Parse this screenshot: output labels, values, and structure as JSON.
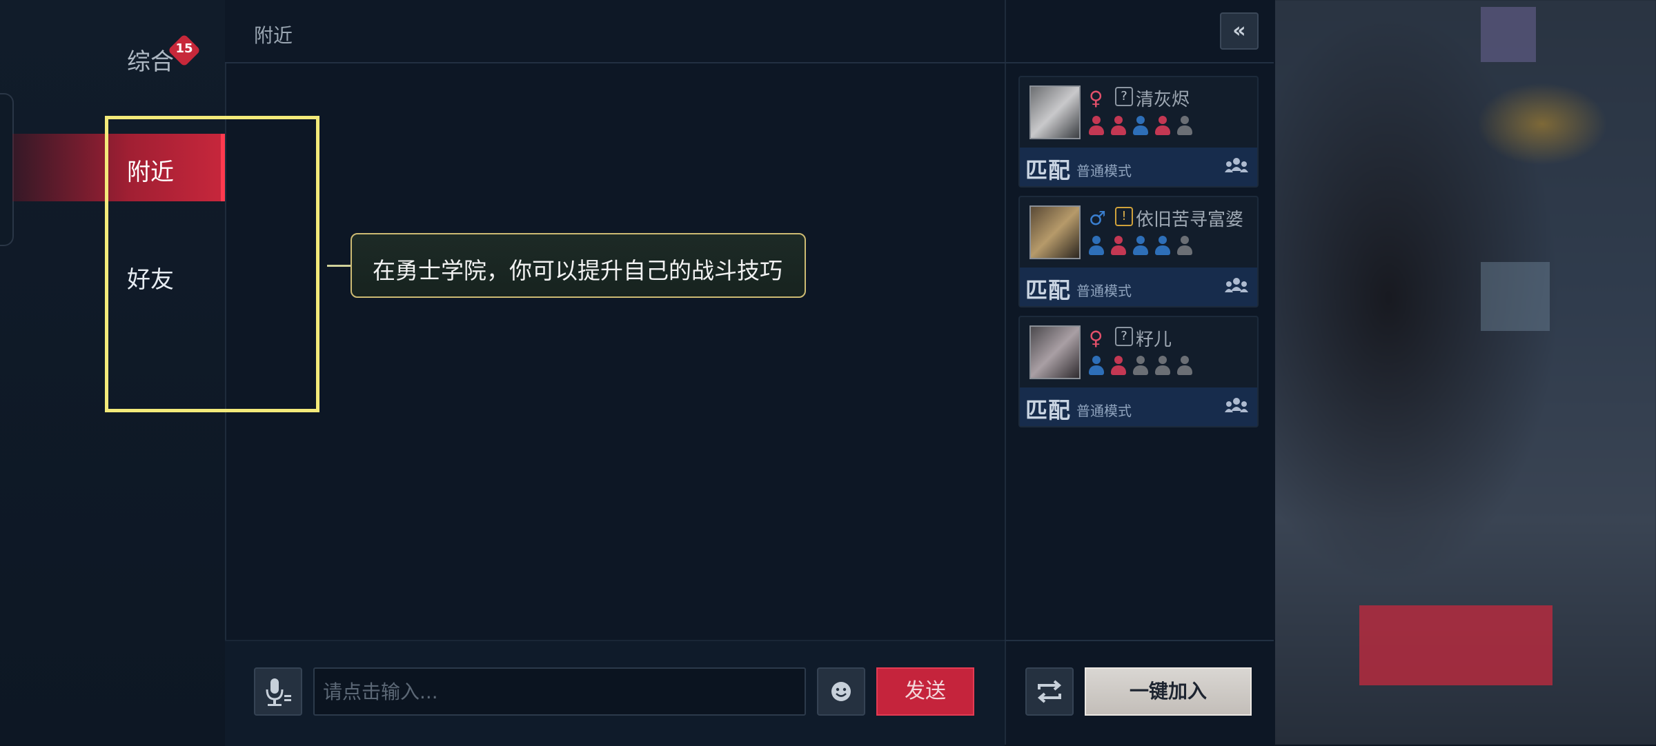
{
  "sidebar": {
    "items": [
      {
        "label": "综合",
        "badge": "15"
      },
      {
        "label": "附近"
      },
      {
        "label": "好友"
      }
    ],
    "selected": "附近"
  },
  "chat": {
    "title": "附近",
    "tip": "在勇士学院，你可以提升自己的战斗技巧",
    "input_placeholder": "请点击输入...",
    "send_label": "发送"
  },
  "players": {
    "collapse_icon": "«",
    "list": [
      {
        "gender": "♀",
        "gender_color": "#e2506a",
        "rank_icon": "?",
        "name": "清灰烬",
        "slots": [
          "#c43853",
          "#c43853",
          "#2e6fb8",
          "#c43853",
          "#6b6f75"
        ],
        "match_label": "匹配",
        "mode": "普通模式"
      },
      {
        "gender": "♂",
        "gender_color": "#3a7fd0",
        "rank_icon": "!",
        "name": "依旧苦寻富婆",
        "slots": [
          "#2e6fb8",
          "#c43853",
          "#2e6fb8",
          "#2e6fb8",
          "#6b6f75"
        ],
        "match_label": "匹配",
        "mode": "普通模式"
      },
      {
        "gender": "♀",
        "gender_color": "#e2506a",
        "rank_icon": "?",
        "name": "籽儿",
        "slots": [
          "#2e6fb8",
          "#c43853",
          "#6b6f75",
          "#6b6f75",
          "#6b6f75"
        ],
        "match_label": "匹配",
        "mode": "普通模式"
      }
    ],
    "join_all_label": "一键加入"
  },
  "colors": {
    "accent_red": "#c5243c",
    "highlight": "#f3ea7a",
    "panel_bg": "#0d1725"
  }
}
